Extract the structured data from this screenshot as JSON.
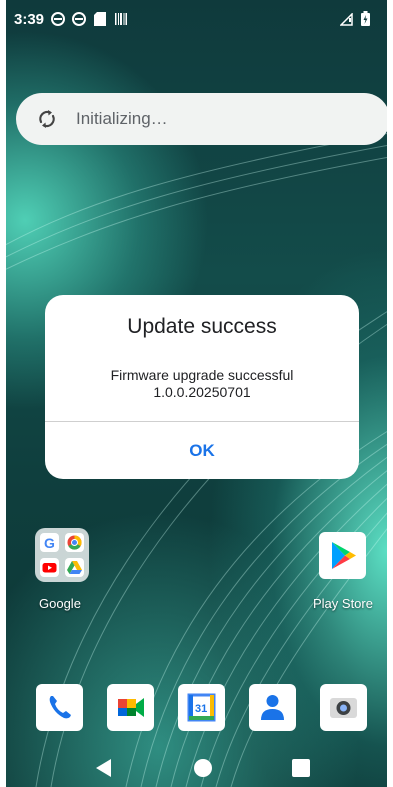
{
  "status_bar": {
    "time": "3:39",
    "icons": [
      "circle-notification-icon",
      "circle-notification-icon",
      "sd-card-icon",
      "barcode-icon"
    ],
    "right_icons": [
      "signal-icon",
      "battery-icon"
    ]
  },
  "search": {
    "text": "Initializing…",
    "icon": "sync-icon"
  },
  "dialog": {
    "title": "Update success",
    "message": "Firmware upgrade successful",
    "version": "1.0.0.20250701",
    "ok_label": "OK",
    "ok_color": "#1a73e8"
  },
  "home": {
    "folder_label": "Google",
    "play_store_label": "Play Store"
  },
  "dock": [
    "phone-icon",
    "meet-icon",
    "calendar-icon",
    "contacts-icon",
    "camera-icon"
  ],
  "calendar_day": "31",
  "nav": [
    "back-icon",
    "home-icon",
    "recents-icon"
  ]
}
